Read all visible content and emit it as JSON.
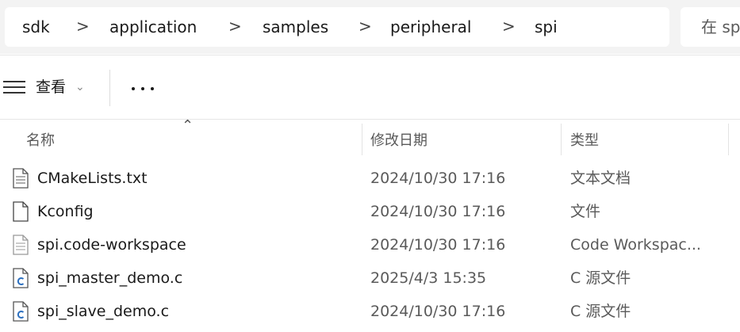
{
  "breadcrumb": {
    "items": [
      "sdk",
      "application",
      "samples",
      "peripheral",
      "spi"
    ],
    "separator": ">"
  },
  "search": {
    "placeholder": "在 sp"
  },
  "toolbar": {
    "view_label": "查看",
    "view_icon": "lines-icon",
    "dropdown_icon": "chevron-down-icon",
    "more_label": "..."
  },
  "columns": {
    "name": "名称",
    "date": "修改日期",
    "type": "类型"
  },
  "files": [
    {
      "name": "CMakeLists.txt",
      "date": "2024/10/30 17:16",
      "type": "文本文档",
      "icon": "text-file-icon"
    },
    {
      "name": "Kconfig",
      "date": "2024/10/30 17:16",
      "type": "文件",
      "icon": "file-icon"
    },
    {
      "name": "spi.code-workspace",
      "date": "2024/10/30 17:16",
      "type": "Code Workspac...",
      "icon": "workspace-file-icon"
    },
    {
      "name": "spi_master_demo.c",
      "date": "2025/4/3 15:35",
      "type": "C 源文件",
      "icon": "c-file-icon"
    },
    {
      "name": "spi_slave_demo.c",
      "date": "2024/10/30 17:16",
      "type": "C 源文件",
      "icon": "c-file-icon"
    }
  ],
  "colors": {
    "accent": "#2b6fbf",
    "window_bg": "#f3f3f3"
  }
}
